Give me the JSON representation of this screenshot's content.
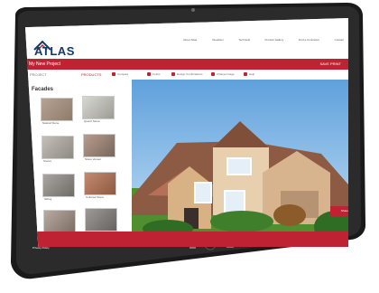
{
  "app": {
    "name": "ATLAS"
  },
  "topnav": [
    "About Atlas",
    "Visualizer",
    "Technical",
    "Product Gallery",
    "Find a Contractor",
    "Contact"
  ],
  "project": {
    "title": "My New Project",
    "right_text": "SAVE PRINT"
  },
  "tabs": [
    "PROJECT",
    "PRODUCTS"
  ],
  "tools": [
    "Compare",
    "Colors",
    "Design Combinations",
    "Change Image",
    "Help"
  ],
  "sidebar": {
    "title": "Facades",
    "swatches": [
      {
        "label": "Natural Stone"
      },
      {
        "label": "Quartz Stone"
      },
      {
        "label": "Stucco"
      },
      {
        "label": "Stone Veneer"
      },
      {
        "label": "Siding"
      },
      {
        "label": "Cultured Stone"
      },
      {
        "label": "Brick"
      },
      {
        "label": "Slate"
      }
    ]
  },
  "actions": {
    "primary": "Share Project",
    "bottom_note": "Privacy Policy"
  },
  "colors": {
    "brand_red": "#bf2233",
    "navy": "#123a67"
  }
}
